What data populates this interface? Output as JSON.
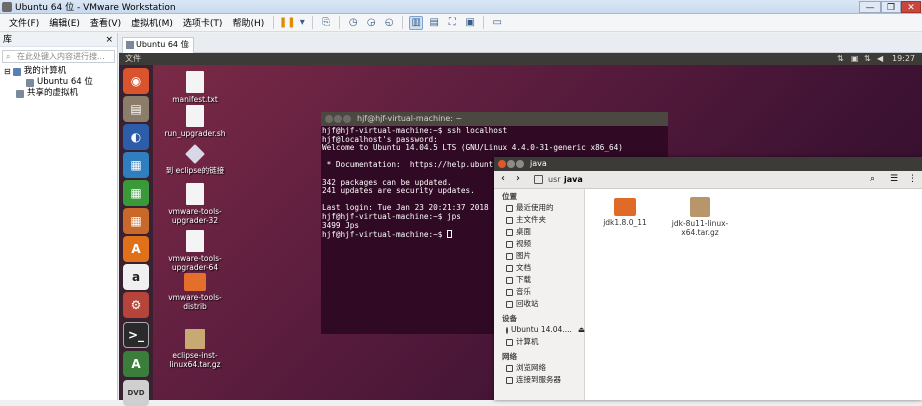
{
  "window": {
    "title": "Ubuntu 64 位 - VMware Workstation",
    "min": "—",
    "max": "❐",
    "close": "✕"
  },
  "menu": [
    "文件(F)",
    "编辑(E)",
    "查看(V)",
    "虚拟机(M)",
    "选项卡(T)",
    "帮助(H)"
  ],
  "library": {
    "title": "库",
    "close": "×",
    "search_placeholder": "在此处键入内容进行搜...",
    "tree": [
      {
        "label": "我的计算机",
        "expander": "⊟"
      },
      {
        "label": "Ubuntu 64 位"
      },
      {
        "label": "共享的虚拟机"
      }
    ]
  },
  "vm_tab": {
    "label": "Ubuntu 64 位",
    "close": "×"
  },
  "ubuntu": {
    "panel_left": "文件",
    "time": "19:27",
    "desktop_icons": [
      {
        "label": "manifest.txt"
      },
      {
        "label": "run_upgrader.sh"
      },
      {
        "label": "到 eclipse的链接"
      },
      {
        "label": "vmware-tools-upgrader-32"
      },
      {
        "label": "vmware-tools-upgrader-64"
      },
      {
        "label": "vmware-tools-distrib"
      },
      {
        "label": "eclipse-inst-linux64.tar.gz"
      }
    ],
    "launcher_icons": [
      "ubuntu-icon",
      "files-icon",
      "firefox-icon",
      "writer-icon",
      "calc-icon",
      "impress-icon",
      "software-center-icon",
      "amazon-icon",
      "settings-icon",
      "terminal-icon",
      "updater-icon",
      "dvd-icon"
    ]
  },
  "terminal": {
    "title": "hjf@hjf-virtual-machine: ~",
    "lines": "hjf@hjf-virtual-machine:~$ ssh localhost\nhjf@localhost's password:\nWelcome to Ubuntu 14.04.5 LTS (GNU/Linux 4.4.0-31-generic x86_64)\n\n * Documentation:  https://help.ubuntu.c\n\n342 packages can be updated.\n241 updates are security updates.\n\nLast login: Tue Jan 23 20:21:37 2018 fro\nhjf@hjf-virtual-machine:~$ jps\n3499 Jps\nhjf@hjf-virtual-machine:~$ "
  },
  "filemanager": {
    "title": "java",
    "path": [
      "usr",
      "java"
    ],
    "sections": {
      "places": "位置",
      "devices": "设备",
      "network": "网络"
    },
    "places": [
      "最近使用的",
      "主文件夹",
      "桌面",
      "视频",
      "图片",
      "文档",
      "下载",
      "音乐",
      "回收站"
    ],
    "devices": [
      "Ubuntu 14.04....",
      "计算机"
    ],
    "network": [
      "浏览网络",
      "连接到服务器"
    ],
    "files": [
      {
        "label": "jdk1.8.0_11",
        "kind": "folder"
      },
      {
        "label": "jdk-8u11-linux-x64.tar.gz",
        "kind": "archive"
      }
    ]
  }
}
